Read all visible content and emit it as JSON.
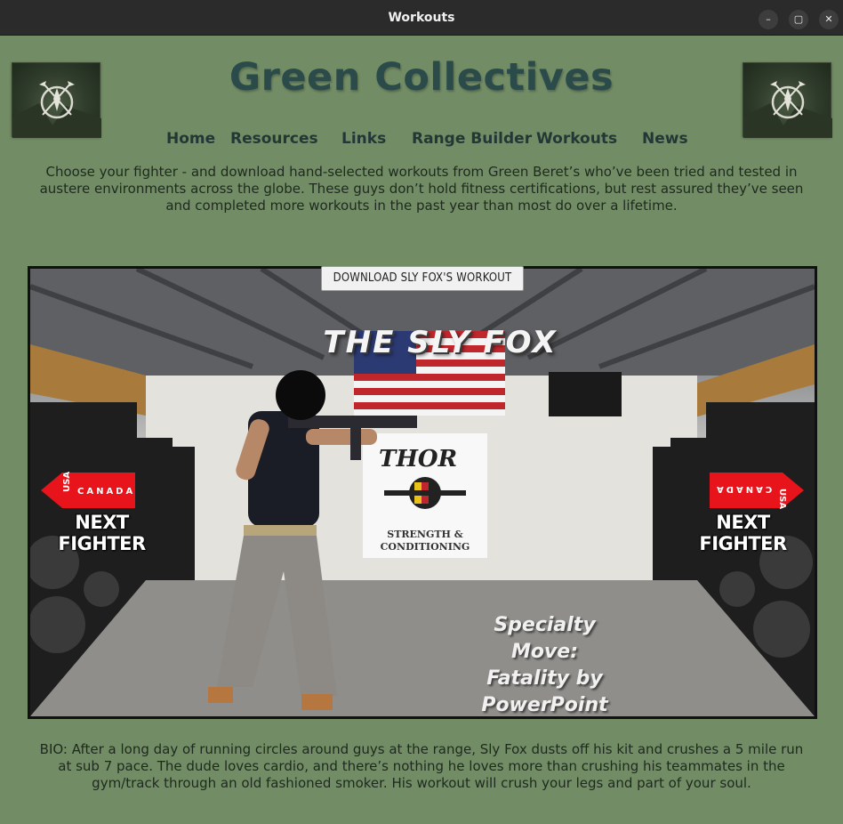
{
  "window": {
    "title": "Workouts",
    "min_icon": "minimize-icon",
    "max_icon": "maximize-icon",
    "close_icon": "close-icon"
  },
  "header": {
    "site_title": "Green Collectives",
    "logo_left": "special-forces-crest-logo",
    "logo_right": "special-forces-crest-logo"
  },
  "nav": {
    "items": [
      {
        "label": "Home"
      },
      {
        "label": "Resources"
      },
      {
        "label": "Links"
      },
      {
        "label": "Range Builder"
      },
      {
        "label": "Workouts"
      },
      {
        "label": "News"
      }
    ]
  },
  "intro": "Choose your fighter - and download hand-selected workouts from Green Beret’s who’ve been tried and tested in austere environments across the globe. These guys don’t hold fitness certifications, but rest assured they’ve seen and completed more workouts in the past year than most do over a lifetime.",
  "hero": {
    "download_label": "DOWNLOAD SLY FOX'S WORKOUT",
    "fighter_name": "THE SLY FOX",
    "next_left_label": "NEXT FIGHTER",
    "next_right_label": "NEXT FIGHTER",
    "tab_text_usa": "USA",
    "tab_text_canada": "CANADA",
    "gym_sign_line1": "THOR",
    "gym_sign_line2": "STRENGTH &",
    "gym_sign_line3": "CONDITIONING",
    "specialty_line1": "Specialty",
    "specialty_line2": "Move:",
    "specialty_line3": "Fatality by",
    "specialty_line4": "PowerPoint"
  },
  "bio": "BIO: After a long day of running circles around guys at the range, Sly Fox dusts off his kit and crushes a 5 mile run at sub 7 pace. The dude loves cardio, and there’s nothing he loves more than crushing his teammates in the gym/track through an old fashioned smoker. His workout will crush your legs and part of your soul.",
  "colors": {
    "page_bg": "#728c65",
    "title_color": "#2b4a4a",
    "nav_color": "#233836",
    "arrow_red": "#e8141c"
  }
}
